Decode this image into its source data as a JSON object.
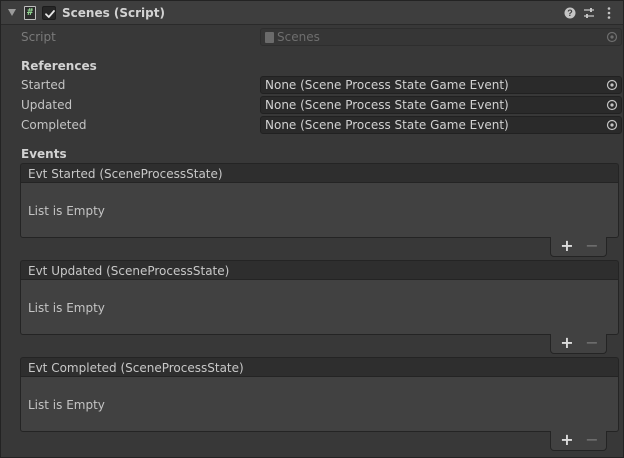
{
  "header": {
    "title": "Scenes (Script)",
    "script_icon_glyph": "#",
    "enabled": true,
    "icons": [
      "foldout-arrow-icon",
      "script-icon",
      "help-icon",
      "presets-icon",
      "more-menu-icon"
    ]
  },
  "script_row": {
    "label": "Script",
    "value": "Scenes"
  },
  "references": {
    "title": "References",
    "fields": [
      {
        "label": "Started",
        "value": "None (Scene Process State Game Event)"
      },
      {
        "label": "Updated",
        "value": "None (Scene Process State Game Event)"
      },
      {
        "label": "Completed",
        "value": "None (Scene Process State Game Event)"
      }
    ]
  },
  "events": {
    "title": "Events",
    "lists": [
      {
        "header": "Evt Started (SceneProcessState)",
        "empty_text": "List is Empty",
        "add_label": "+",
        "remove_label": "−"
      },
      {
        "header": "Evt Updated (SceneProcessState)",
        "empty_text": "List is Empty",
        "add_label": "+",
        "remove_label": "−"
      },
      {
        "header": "Evt Completed (SceneProcessState)",
        "empty_text": "List is Empty",
        "add_label": "+",
        "remove_label": "−"
      }
    ]
  },
  "colors": {
    "background": "#383838",
    "header_bg": "#3e3e3e",
    "field_bg": "#2a2a2a",
    "list_body_bg": "#414141",
    "text": "#c4c4c4"
  }
}
